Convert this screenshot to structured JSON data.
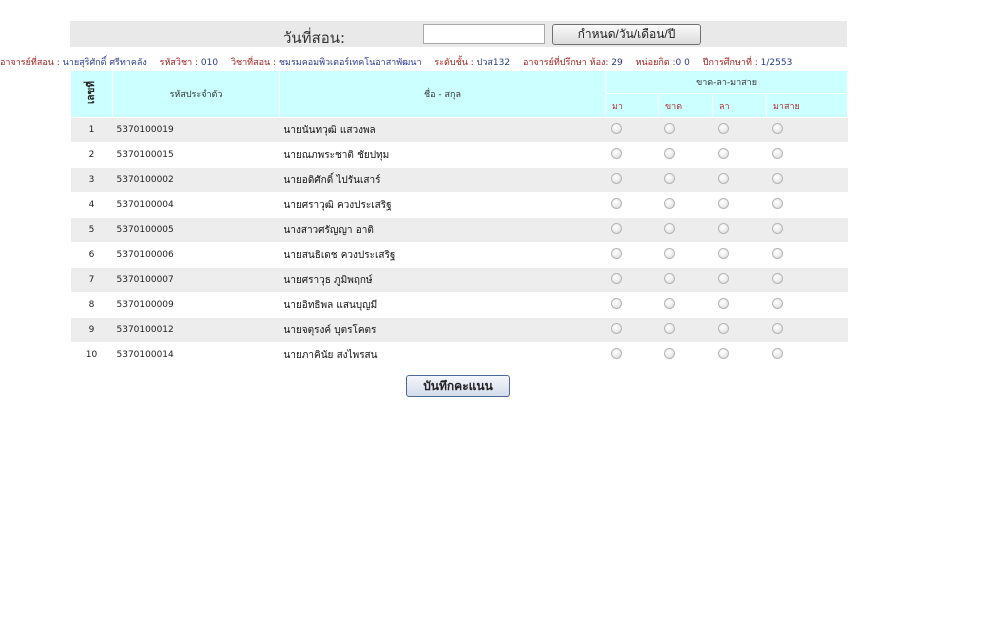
{
  "topbar": {
    "date_label": "วันที่สอน:",
    "date_value": "",
    "set_date_button": "กำหนด/วัน/เดือน/ปี"
  },
  "info": {
    "teacher_key": "อาจารย์ที่สอน : ",
    "teacher_value": "นายสุริศักดิ์ ศรีทาคลัง",
    "course_code_key": "รหัสวิชา : ",
    "course_code_value": "010",
    "subject_key": "วิชาที่สอน : ",
    "subject_value": "ชมรมคอมพิวเตอร์เทคโนอาสาพัฒนา",
    "level_key": "ระดับชั้น : ",
    "level_value": "ปวส132",
    "advisor_key": "อาจารย์ที่ปรึกษา ห้อง: ",
    "advisor_value": "29",
    "credit_key": "หน่อยกิต :",
    "credit_value": "0 0",
    "year_key": "ปีการศึกษาที่ : ",
    "year_value": "1/2553"
  },
  "table": {
    "headers": {
      "no": "เลขที่",
      "student_id": "รหัสประจำตัว",
      "name": "ชื่อ - สกุล",
      "status_group": "ขาด-ลา-มาสาย",
      "present": "มา",
      "absent": "ขาด",
      "leave": "ลา",
      "late": "มาสาย"
    },
    "rows": [
      {
        "no": "1",
        "id": "5370100019",
        "name": "นายนันทวุฒิ แสวงพล"
      },
      {
        "no": "2",
        "id": "5370100015",
        "name": "นายณภพระชาติ ชัยปทุม"
      },
      {
        "no": "3",
        "id": "5370100002",
        "name": "นายอดิศักดิ์ ไปรันเสาร์"
      },
      {
        "no": "4",
        "id": "5370100004",
        "name": "นายศราวุฒิ ควงประเสริฐ"
      },
      {
        "no": "5",
        "id": "5370100005",
        "name": "นางสาวศรัญญา อาติ"
      },
      {
        "no": "6",
        "id": "5370100006",
        "name": "นายสนธิเดช ควงประเสริฐ"
      },
      {
        "no": "7",
        "id": "5370100007",
        "name": "นายศราวุธ ภูมิพฤกษ์"
      },
      {
        "no": "8",
        "id": "5370100009",
        "name": "นายอิทธิพล แสนบุญมี"
      },
      {
        "no": "9",
        "id": "5370100012",
        "name": "นายจตุรงค์ บุตรโคตร"
      },
      {
        "no": "10",
        "id": "5370100014",
        "name": "นายภาคินัย สงไพรสน"
      }
    ]
  },
  "save_button": "บันทึกคะแนน"
}
